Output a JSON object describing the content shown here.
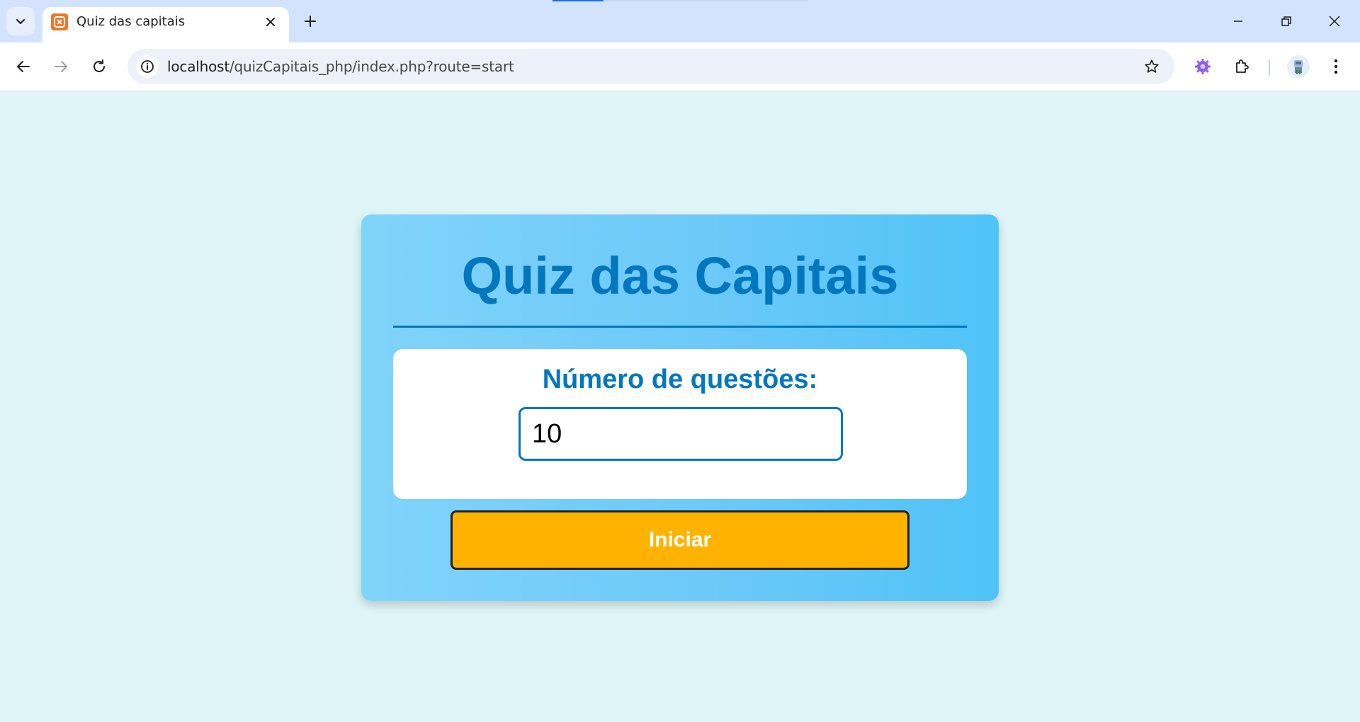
{
  "browser": {
    "tab": {
      "title": "Quiz das capitais",
      "favicon": "xampp-icon"
    },
    "address_bar": {
      "host": "localhost",
      "path": "/quizCapitais_php/index.php?route=start"
    }
  },
  "page": {
    "title": "Quiz das Capitais",
    "question_count_label": "Número de questões:",
    "question_count_value": "10",
    "start_button_label": "Iniciar"
  },
  "colors": {
    "page_background": "#dff5f7",
    "card_gradient_start": "#81d4fa",
    "card_gradient_end": "#4fc3f7",
    "title_blue": "#0277bd",
    "button_amber": "#ffb300"
  }
}
